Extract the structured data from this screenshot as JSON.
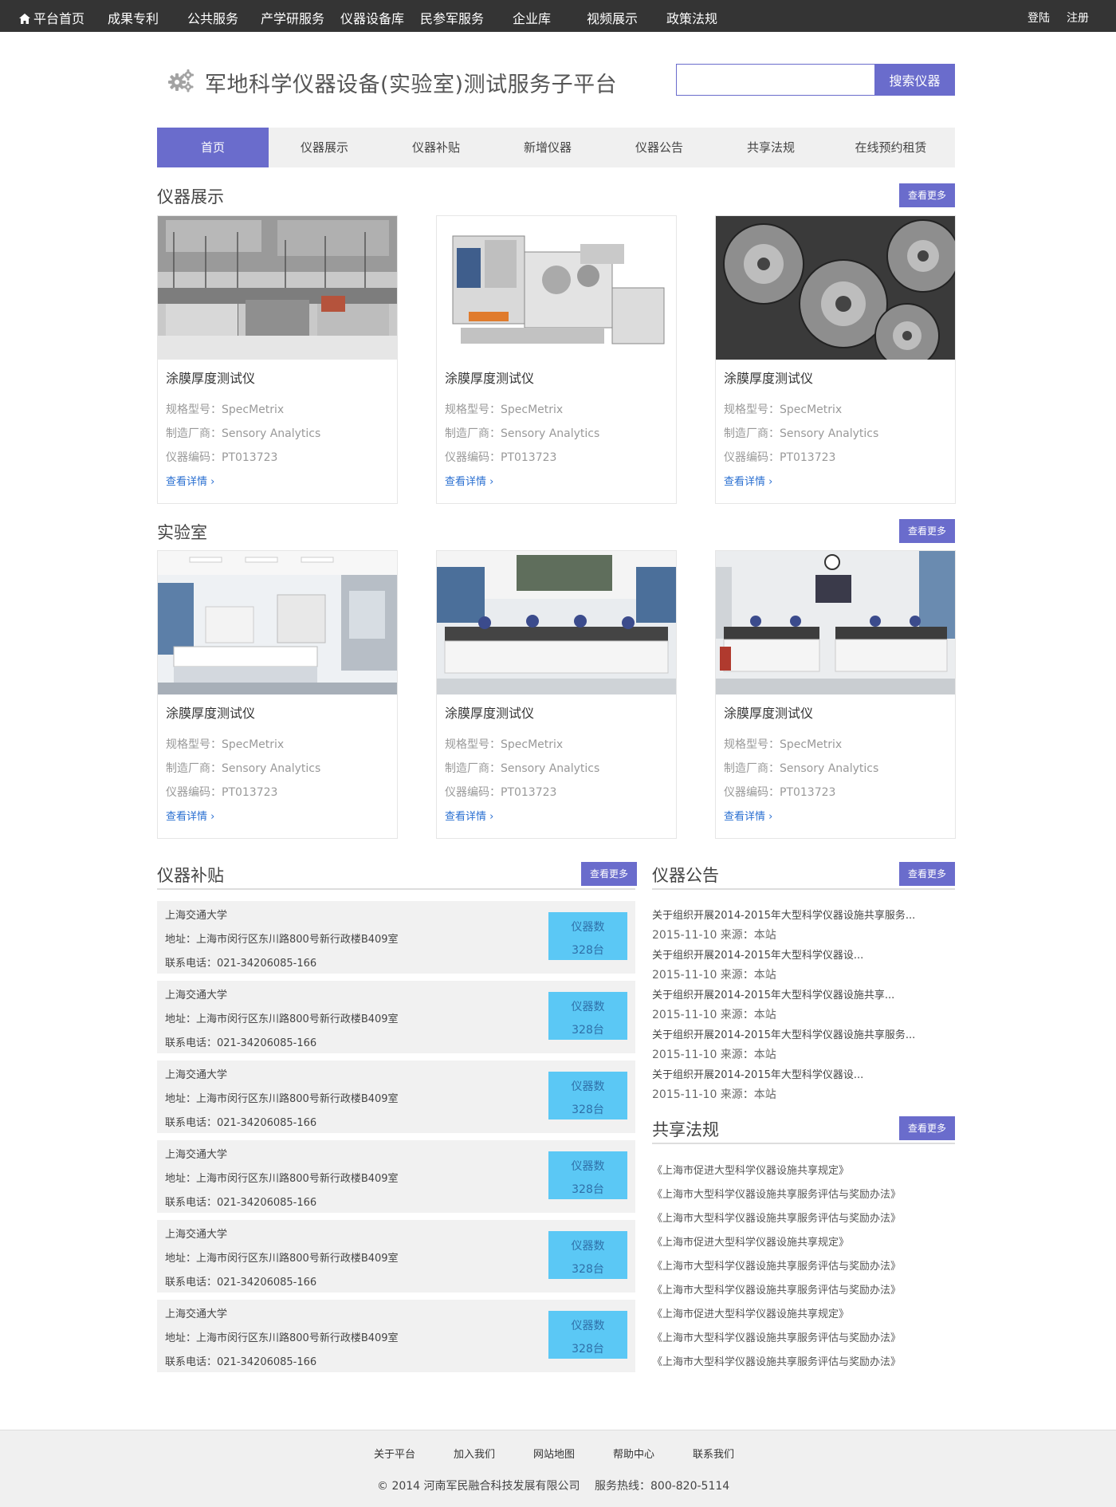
{
  "top_nav": {
    "items": [
      "平台首页",
      "成果专利",
      "公共服务",
      "产学研服务",
      "仪器设备库",
      "民参军服务",
      "企业库",
      "视频展示",
      "政策法规"
    ],
    "login": "登陆",
    "register": "注册"
  },
  "header": {
    "title": "军地科学仪器设备(实验室)测试服务子平台",
    "search_value": "",
    "search_button": "搜索仪器"
  },
  "sub_nav": {
    "tabs": [
      "首页",
      "仪器展示",
      "仪器补贴",
      "新增仪器",
      "仪器公告",
      "共享法规",
      "在线预约租赁"
    ],
    "active": "首页"
  },
  "colors": {
    "accent": "#6a6ccc",
    "topbar": "#343434",
    "count_box": "#5bc8f5",
    "link": "#2a6fd1"
  },
  "instrument_section": {
    "title": "仪器展示",
    "more": "查看更多",
    "cards": [
      {
        "name": "涂膜厚度测试仪",
        "model": "规格型号：SpecMetrix",
        "maker": "制造厂商：Sensory Analytics",
        "code": "仪器编码：PT013723",
        "link": "查看详情",
        "image": "kitchen-equipment-photo"
      },
      {
        "name": "涂膜厚度测试仪",
        "model": "规格型号：SpecMetrix",
        "maker": "制造厂商：Sensory Analytics",
        "code": "仪器编码：PT013723",
        "link": "查看详情",
        "image": "printing-press-photo"
      },
      {
        "name": "涂膜厚度测试仪",
        "model": "规格型号：SpecMetrix",
        "maker": "制造厂商：Sensory Analytics",
        "code": "仪器编码：PT013723",
        "link": "查看详情",
        "image": "gears-photo"
      }
    ]
  },
  "lab_section": {
    "title": "实验室",
    "more": "查看更多",
    "cards": [
      {
        "name": "涂膜厚度测试仪",
        "model": "规格型号：SpecMetrix",
        "maker": "制造厂商：Sensory Analytics",
        "code": "仪器编码：PT013723",
        "link": "查看详情",
        "image": "laboratory-photo"
      },
      {
        "name": "涂膜厚度测试仪",
        "model": "规格型号：SpecMetrix",
        "maker": "制造厂商：Sensory Analytics",
        "code": "仪器编码：PT013723",
        "link": "查看详情",
        "image": "microscope-lab-photo"
      },
      {
        "name": "涂膜厚度测试仪",
        "model": "规格型号：SpecMetrix",
        "maker": "制造厂商：Sensory Analytics",
        "code": "仪器编码：PT013723",
        "link": "查看详情",
        "image": "classroom-lab-photo"
      }
    ]
  },
  "subsidy_section": {
    "title": "仪器补贴",
    "more": "查看更多",
    "items": [
      {
        "org": "上海交通大学",
        "address": "地址：上海市闵行区东川路800号新行政楼B409室",
        "phone": "联系电话：021-34206085-166",
        "count_label": "仪器数",
        "count": "328台"
      },
      {
        "org": "上海交通大学",
        "address": "地址：上海市闵行区东川路800号新行政楼B409室",
        "phone": "联系电话：021-34206085-166",
        "count_label": "仪器数",
        "count": "328台"
      },
      {
        "org": "上海交通大学",
        "address": "地址：上海市闵行区东川路800号新行政楼B409室",
        "phone": "联系电话：021-34206085-166",
        "count_label": "仪器数",
        "count": "328台"
      },
      {
        "org": "上海交通大学",
        "address": "地址：上海市闵行区东川路800号新行政楼B409室",
        "phone": "联系电话：021-34206085-166",
        "count_label": "仪器数",
        "count": "328台"
      },
      {
        "org": "上海交通大学",
        "address": "地址：上海市闵行区东川路800号新行政楼B409室",
        "phone": "联系电话：021-34206085-166",
        "count_label": "仪器数",
        "count": "328台"
      },
      {
        "org": "上海交通大学",
        "address": "地址：上海市闵行区东川路800号新行政楼B409室",
        "phone": "联系电话：021-34206085-166",
        "count_label": "仪器数",
        "count": "328台"
      }
    ]
  },
  "notice_section": {
    "title": "仪器公告",
    "more": "查看更多",
    "items": [
      {
        "title": "关于组织开展2014-2015年大型科学仪器设施共享服务...",
        "meta": "2015-11-10  来源：本站"
      },
      {
        "title": "关于组织开展2014-2015年大型科学仪器设...",
        "meta": "2015-11-10  来源：本站"
      },
      {
        "title": "关于组织开展2014-2015年大型科学仪器设施共享...",
        "meta": "2015-11-10  来源：本站"
      },
      {
        "title": "关于组织开展2014-2015年大型科学仪器设施共享服务...",
        "meta": "2015-11-10  来源：本站"
      },
      {
        "title": "关于组织开展2014-2015年大型科学仪器设...",
        "meta": "2015-11-10  来源：本站"
      }
    ]
  },
  "law_section": {
    "title": "共享法规",
    "more": "查看更多",
    "items": [
      "《上海市促进大型科学仪器设施共享规定》",
      "《上海市大型科学仪器设施共享服务评估与奖励办法》",
      "《上海市大型科学仪器设施共享服务评估与奖励办法》",
      "《上海市促进大型科学仪器设施共享规定》",
      "《上海市大型科学仪器设施共享服务评估与奖励办法》",
      "《上海市大型科学仪器设施共享服务评估与奖励办法》",
      "《上海市促进大型科学仪器设施共享规定》",
      "《上海市大型科学仪器设施共享服务评估与奖励办法》",
      "《上海市大型科学仪器设施共享服务评估与奖励办法》"
    ]
  },
  "footer": {
    "links": [
      "关于平台",
      "加入我们",
      "网站地图",
      "帮助中心",
      "联系我们"
    ],
    "copyright": "© 2014 河南军民融合科技发展有限公司",
    "hotline": "服务热线：800-820-5114"
  }
}
